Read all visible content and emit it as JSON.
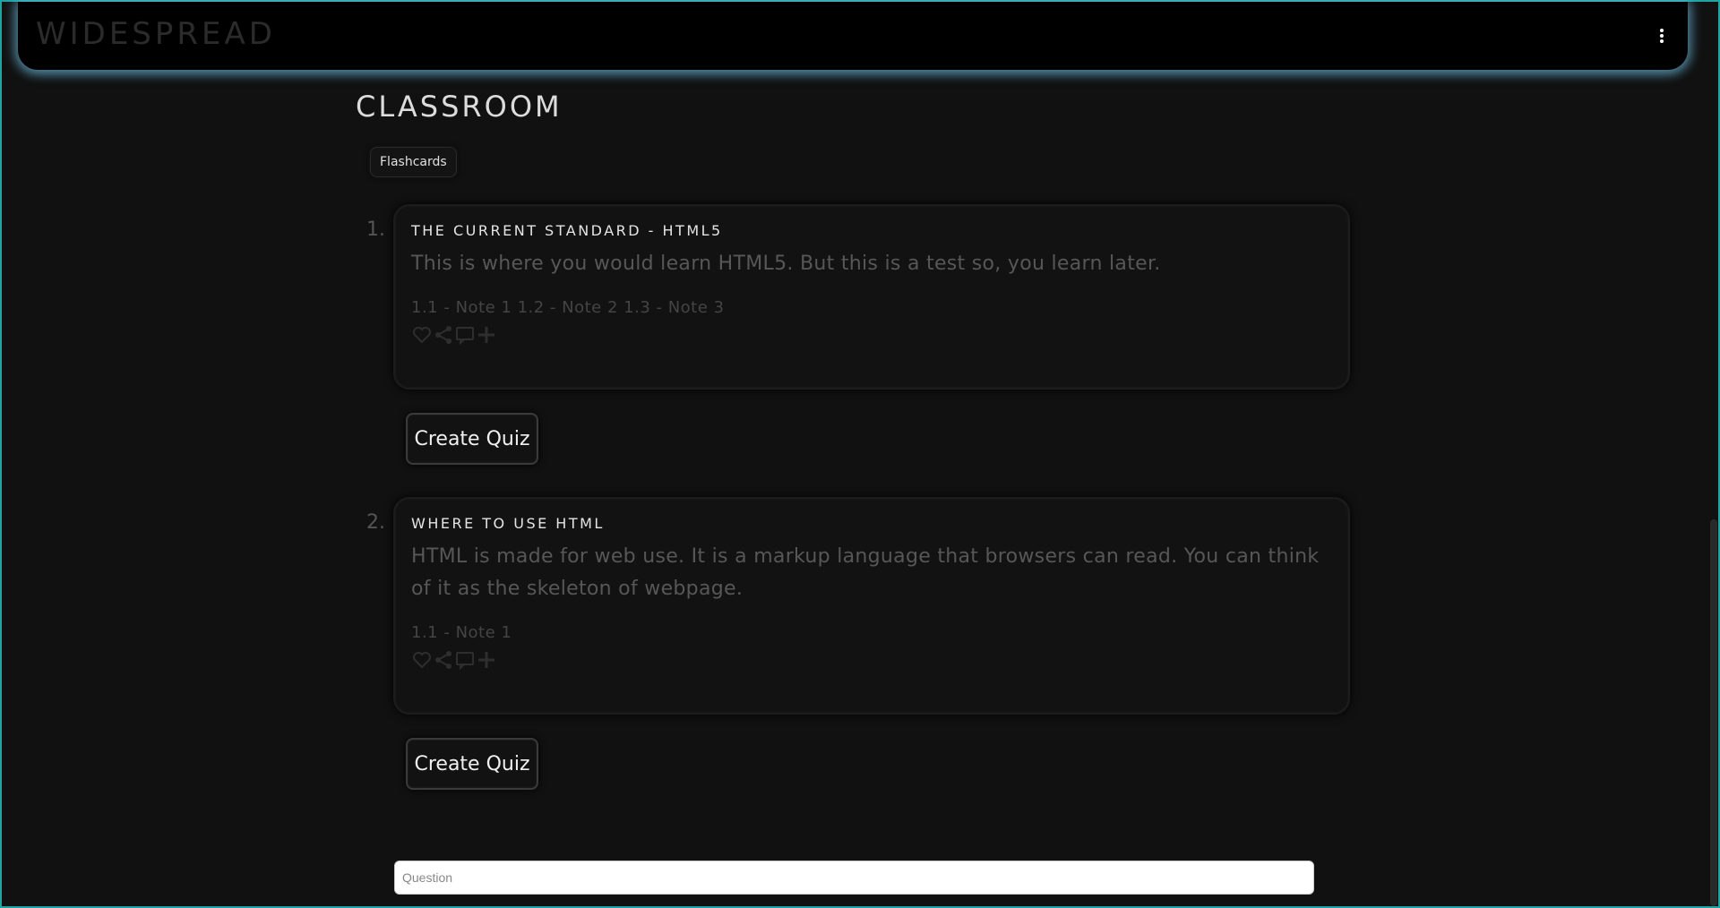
{
  "navbar": {
    "brand": "WIDESPREAD",
    "menu_icon": "vertical-ellipsis-icon"
  },
  "page": {
    "title": "CLASSROOM",
    "tab_label": "Flashcards"
  },
  "lessons": [
    {
      "number": "1.",
      "title": "THE CURRENT STANDARD - HTML5",
      "body": "This is where you would learn HTML5. But this is a test so, you learn later.",
      "notes": "1.1 - Note 1 1.2 - Note 2 1.3 - Note 3",
      "action_icons": [
        "heart-icon",
        "share-icon",
        "comment-icon",
        "plus-icon"
      ],
      "button_label": "Create Quiz"
    },
    {
      "number": "2.",
      "title": "WHERE TO USE HTML",
      "body": "HTML is made for web use. It is a markup language that browsers can read. You can think of it as the skeleton of webpage.",
      "notes": "1.1 - Note 1",
      "action_icons": [
        "heart-icon",
        "share-icon",
        "comment-icon",
        "plus-icon"
      ],
      "button_label": "Create Quiz"
    }
  ],
  "question_input": {
    "placeholder": "Question",
    "value": ""
  },
  "colors": {
    "background": "#111111",
    "frame_accent": "#1fa3a3",
    "navbar_glow": "#6ebee1"
  }
}
